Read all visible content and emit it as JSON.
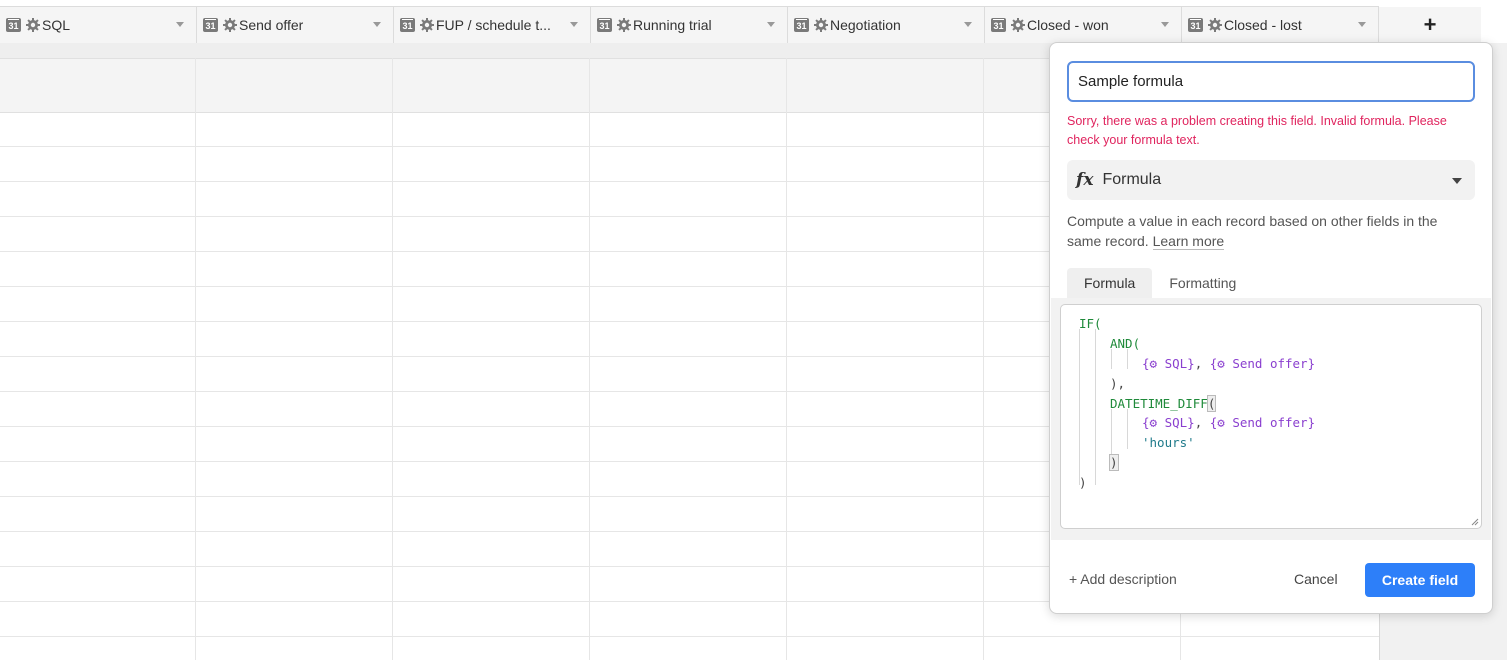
{
  "columns": [
    {
      "label": "SQL"
    },
    {
      "label": "Send offer"
    },
    {
      "label": "FUP / schedule t..."
    },
    {
      "label": "Running trial"
    },
    {
      "label": "Negotiation"
    },
    {
      "label": "Closed - won"
    },
    {
      "label": "Closed - lost"
    }
  ],
  "column_icon_text": "31",
  "add_column_label": "+",
  "dialog": {
    "field_name": "Sample formula",
    "error": "Sorry, there was a problem creating this field. Invalid formula. Please check your formula text.",
    "field_type": "Formula",
    "type_icon": "fx",
    "description": "Compute a value in each record based on other fields in the same record.",
    "learn_more": "Learn more",
    "tabs": [
      "Formula",
      "Formatting"
    ],
    "code": {
      "l1": "IF(",
      "l2": "AND(",
      "l3a": "{⚙ SQL}",
      "l3b": ", ",
      "l3c": "{⚙ Send offer}",
      "l4": "),",
      "l5": "DATETIME_DIFF",
      "l5b": "(",
      "l6a": "{⚙ SQL}",
      "l6b": ", ",
      "l6c": "{⚙ Send offer}",
      "l7": "'hours'",
      "l8": ")",
      "l9": ")"
    },
    "add_description": "+ Add description",
    "cancel": "Cancel",
    "create": "Create field"
  },
  "colors": {
    "accent": "#2d7ff9",
    "error": "#e0245e",
    "keyword": "#1f8a3a",
    "field_ref": "#8a3fcf"
  }
}
